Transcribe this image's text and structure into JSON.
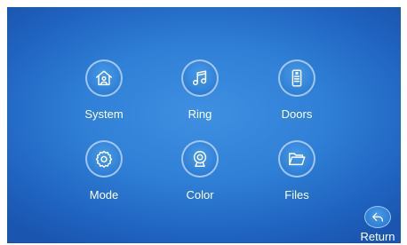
{
  "menu": {
    "items": [
      {
        "label": "System",
        "icon": "home-icon"
      },
      {
        "label": "Ring",
        "icon": "music-note-icon"
      },
      {
        "label": "Doors",
        "icon": "door-intercom-icon"
      },
      {
        "label": "Mode",
        "icon": "gear-icon"
      },
      {
        "label": "Color",
        "icon": "webcam-icon"
      },
      {
        "label": "Files",
        "icon": "folder-icon"
      }
    ]
  },
  "footer": {
    "return_label": "Return",
    "return_icon": "back-arrow-icon"
  },
  "colors": {
    "background": "#2f7fd6",
    "icon_ring": "#9cc6f2",
    "text": "#ffffff"
  }
}
